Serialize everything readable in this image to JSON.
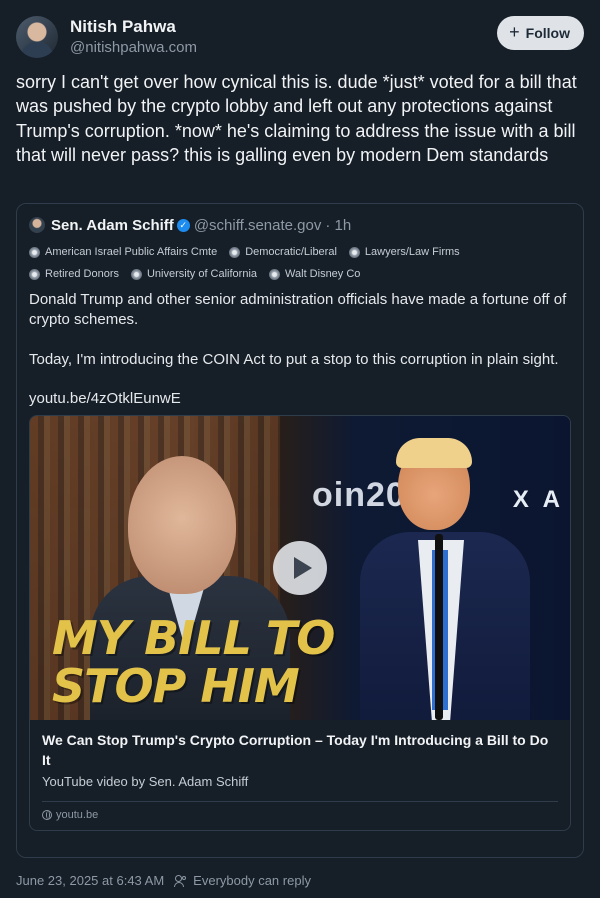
{
  "post": {
    "author": {
      "name": "Nitish Pahwa",
      "handle": "@nitishpahwa.com"
    },
    "follow_label": "Follow",
    "text": "sorry I can't get over how cynical this is. dude *just* voted for a bill that was pushed by the crypto lobby and left out any protections against Trump's corruption. *now* he's claiming to address the issue with a bill that will never pass? this is galling even by modern Dem standards",
    "timestamp": "June 23, 2025 at 6:43 AM",
    "reply_setting": "Everybody can reply"
  },
  "quote": {
    "author": {
      "name": "Sen. Adam Schiff",
      "handle": "@schiff.senate.gov",
      "time": "· 1h"
    },
    "labels": [
      "American Israel Public Affairs Cmte",
      "Democratic/Liberal",
      "Lawyers/Law Firms",
      "Retired Donors",
      "University of California",
      "Walt Disney Co"
    ],
    "text": "Donald Trump and other senior administration officials have made a fortune off of crypto schemes.\n\nToday, I'm introducing the COIN Act to put a stop to this corruption in plain sight.",
    "link": "youtu.be/4zOtklEunwE",
    "embed": {
      "overlay_line1": "MY BILL TO",
      "overlay_line2": "STOP HIM",
      "stage_text": "oin20",
      "stage_text2": "X A",
      "title": "We Can Stop Trump's Crypto Corruption – Today I'm Introducing a Bill to Do It",
      "description": "YouTube video by Sen. Adam Schiff",
      "domain": "youtu.be"
    }
  },
  "icons": {
    "follow": "plus-icon",
    "verified": "verified-check-icon",
    "play": "play-icon",
    "domain": "globe-icon",
    "reply": "people-icon"
  }
}
